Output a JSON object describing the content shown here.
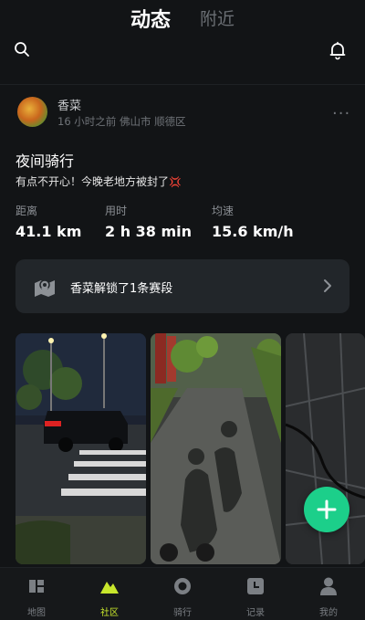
{
  "header": {
    "tabs": [
      {
        "label": "动态",
        "active": true
      },
      {
        "label": "附近",
        "active": false
      }
    ],
    "icons": [
      "search-icon",
      "bell-icon"
    ]
  },
  "post": {
    "username": "香菜",
    "meta": "16 小时之前 佛山市 顺德区",
    "title": "夜间骑行",
    "description": "有点不开心！今晚老地方被封了",
    "description_emoji": "💢",
    "stats": [
      {
        "label": "距离",
        "value": "41.1 km"
      },
      {
        "label": "用时",
        "value": "2 h 38 min"
      },
      {
        "label": "均速",
        "value": "15.6 km/h"
      }
    ],
    "segment_text": "香菜解锁了1条赛段",
    "more_label": "···"
  },
  "fab": {
    "icon": "plus-icon",
    "color": "#1ccf8a"
  },
  "bottom_nav": [
    {
      "label": "地图",
      "icon": "map-icon",
      "active": false
    },
    {
      "label": "社区",
      "icon": "community-icon",
      "active": true
    },
    {
      "label": "骑行",
      "icon": "ride-icon",
      "active": false
    },
    {
      "label": "记录",
      "icon": "record-icon",
      "active": false
    },
    {
      "label": "我的",
      "icon": "profile-icon",
      "active": false
    }
  ],
  "colors": {
    "accent": "#c8e62c",
    "background": "#121416",
    "fab": "#1ccf8a"
  }
}
